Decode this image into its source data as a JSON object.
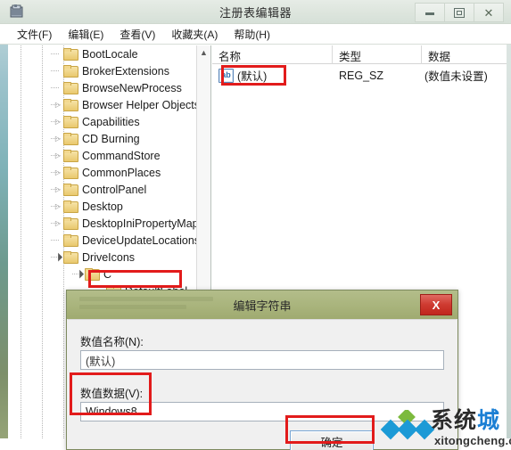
{
  "window": {
    "title": "注册表编辑器",
    "icon": "registry-editor-icon",
    "controls": {
      "minimize": "minimize-icon",
      "maximize": "maximize-icon",
      "close": "close-icon"
    }
  },
  "menubar": {
    "items": [
      {
        "label": "文件(F)"
      },
      {
        "label": "编辑(E)"
      },
      {
        "label": "查看(V)"
      },
      {
        "label": "收藏夹(A)"
      },
      {
        "label": "帮助(H)"
      }
    ]
  },
  "tree": {
    "scroll_up_glyph": "︿",
    "items": [
      {
        "label": "BootLocale",
        "indent": 3,
        "twist": "",
        "selected": false
      },
      {
        "label": "BrokerExtensions",
        "indent": 3,
        "twist": "",
        "selected": false
      },
      {
        "label": "BrowseNewProcess",
        "indent": 3,
        "twist": "",
        "selected": false
      },
      {
        "label": "Browser Helper Objects",
        "indent": 3,
        "twist": "collapsed",
        "selected": false
      },
      {
        "label": "Capabilities",
        "indent": 3,
        "twist": "collapsed",
        "selected": false
      },
      {
        "label": "CD Burning",
        "indent": 3,
        "twist": "collapsed",
        "selected": false
      },
      {
        "label": "CommandStore",
        "indent": 3,
        "twist": "collapsed",
        "selected": false
      },
      {
        "label": "CommonPlaces",
        "indent": 3,
        "twist": "collapsed",
        "selected": false
      },
      {
        "label": "ControlPanel",
        "indent": 3,
        "twist": "collapsed",
        "selected": false
      },
      {
        "label": "Desktop",
        "indent": 3,
        "twist": "collapsed",
        "selected": false
      },
      {
        "label": "DesktopIniPropertyMap",
        "indent": 3,
        "twist": "collapsed",
        "selected": false
      },
      {
        "label": "DeviceUpdateLocations",
        "indent": 3,
        "twist": "",
        "selected": false
      },
      {
        "label": "DriveIcons",
        "indent": 3,
        "twist": "expanded",
        "selected": false
      },
      {
        "label": "C",
        "indent": 4,
        "twist": "expanded",
        "selected": false
      },
      {
        "label": "DefaultLabel",
        "indent": 5,
        "twist": "",
        "selected": true
      }
    ]
  },
  "list": {
    "columns": [
      "名称",
      "类型",
      "数据"
    ],
    "rows": [
      {
        "icon": "string-value-icon",
        "icon_text": "ab",
        "name": "(默认)",
        "type": "REG_SZ",
        "data": "(数值未设置)"
      }
    ]
  },
  "dialog": {
    "title": "编辑字符串",
    "close_label": "X",
    "name_label": "数值名称(N):",
    "name_value": "(默认)",
    "data_label": "数值数据(V):",
    "data_value": "Windows8",
    "ok_label": "确定"
  },
  "watermark": {
    "brand_part1": "系统",
    "brand_part2": "城",
    "url": "xitongcheng.com"
  },
  "colors": {
    "titlebar": "#dde5dd",
    "dialog_titlebar": "#a9b47c",
    "annotation_red": "#e21b1b",
    "dialog_close_red": "#cf3b31",
    "brand_blue": "#1b7fd4",
    "brand_green": "#7cba3d",
    "folder_yellow": "#e9c86d"
  }
}
